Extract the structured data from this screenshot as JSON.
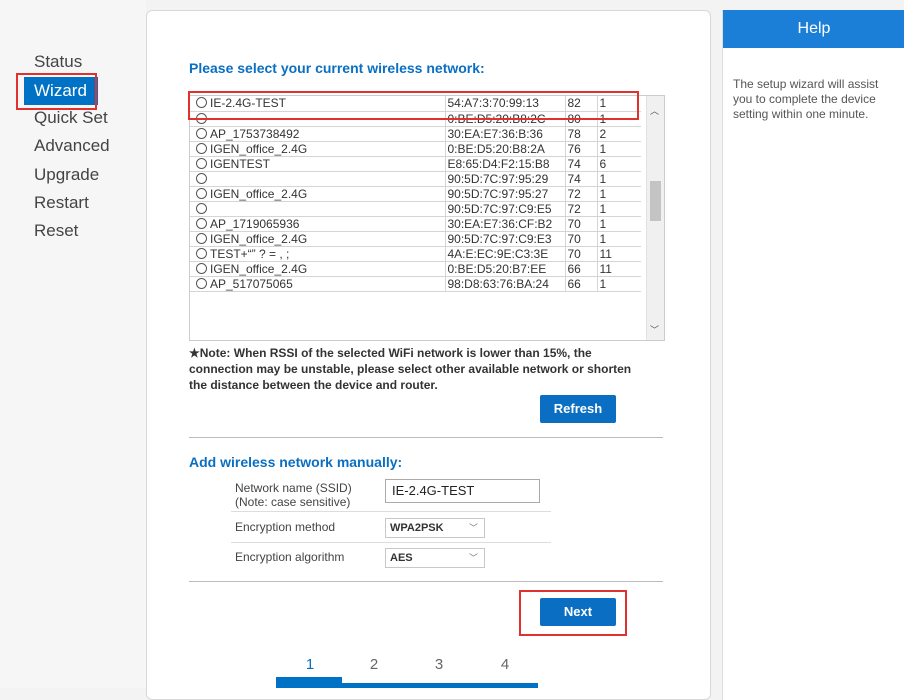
{
  "sidebar": {
    "items": [
      {
        "label": "Status"
      },
      {
        "label": "Wizard"
      },
      {
        "label": "Quick Set"
      },
      {
        "label": "Advanced"
      },
      {
        "label": "Upgrade"
      },
      {
        "label": "Restart"
      },
      {
        "label": "Reset"
      }
    ],
    "active": "Wizard"
  },
  "main": {
    "select_title": "Please select your current wireless network:",
    "networks": [
      {
        "ssid": "IE-2.4G-TEST",
        "mac": "54:A7:3:70:99:13",
        "rssi": "82",
        "channel": "1"
      },
      {
        "ssid": "",
        "mac": "0:BE:D5:20:B8:2C",
        "rssi": "80",
        "channel": "1"
      },
      {
        "ssid": "AP_1753738492",
        "mac": "30:EA:E7:36:B:36",
        "rssi": "78",
        "channel": "2"
      },
      {
        "ssid": "IGEN_office_2.4G",
        "mac": "0:BE:D5:20:B8:2A",
        "rssi": "76",
        "channel": "1"
      },
      {
        "ssid": "IGENTEST",
        "mac": "E8:65:D4:F2:15:B8",
        "rssi": "74",
        "channel": "6"
      },
      {
        "ssid": "",
        "mac": "90:5D:7C:97:95:29",
        "rssi": "74",
        "channel": "1"
      },
      {
        "ssid": "IGEN_office_2.4G",
        "mac": "90:5D:7C:97:95:27",
        "rssi": "72",
        "channel": "1"
      },
      {
        "ssid": "",
        "mac": "90:5D:7C:97:C9:E5",
        "rssi": "72",
        "channel": "1"
      },
      {
        "ssid": "AP_1719065936",
        "mac": "30:EA:E7:36:CF:B2",
        "rssi": "70",
        "channel": "1"
      },
      {
        "ssid": "IGEN_office_2.4G",
        "mac": "90:5D:7C:97:C9:E3",
        "rssi": "70",
        "channel": "1"
      },
      {
        "ssid": "TEST+“” ? = ,   ;",
        "mac": "4A:E:EC:9E:C3:3E",
        "rssi": "70",
        "channel": "11"
      },
      {
        "ssid": "IGEN_office_2.4G",
        "mac": "0:BE:D5:20:B7:EE",
        "rssi": "66",
        "channel": "11"
      },
      {
        "ssid": "AP_517075065",
        "mac": "98:D8:63:76:BA:24",
        "rssi": "66",
        "channel": "1"
      }
    ],
    "note": "★Note: When RSSI of the selected WiFi network is lower than 15%, the connection may be unstable, please select other available network or shorten the distance between the device and router.",
    "refresh_label": "Refresh",
    "manual_title": "Add wireless network manually:",
    "ssid_label": "Network name (SSID)",
    "ssid_note": "(Note: case sensitive)",
    "ssid_value": "IE-2.4G-TEST",
    "encryption_method_label": "Encryption method",
    "encryption_method_value": "WPA2PSK",
    "encryption_algorithm_label": "Encryption algorithm",
    "encryption_algorithm_value": "AES",
    "next_label": "Next",
    "steps": [
      "1",
      "2",
      "3",
      "4"
    ],
    "current_step": "1"
  },
  "help": {
    "title": "Help",
    "text": "The setup wizard will assist you to complete the device setting within one minute."
  },
  "colors": {
    "accent": "#0072c6",
    "highlight": "#e0312f"
  }
}
